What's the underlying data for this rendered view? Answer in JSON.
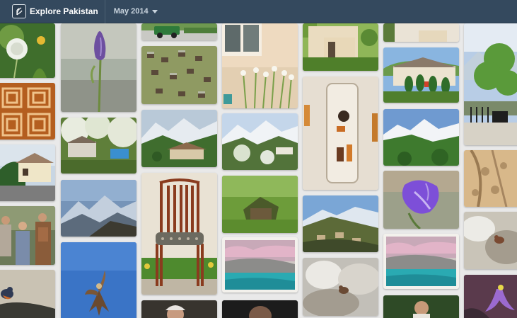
{
  "header": {
    "title": "Explore Pakistan",
    "month": "May 2014",
    "colors": {
      "bar": "#34495e",
      "text": "#ffffff",
      "muted": "#c9d4de"
    }
  },
  "photos": [
    "dandelion",
    "wooden-lattice",
    "village-houses",
    "women-outdoors",
    "perched-bird",
    "purple-iris-bud",
    "blossom-garden",
    "mountain-vista",
    "flying-eagle",
    "green-jeep",
    "hillside-huts",
    "mountain-valley",
    "wooden-chair",
    "portrait",
    "window-flowers",
    "snowy-mountains",
    "grassy-hut",
    "blossom-lake",
    "portrait",
    "yellow-building",
    "wooden-door",
    "valley-houses",
    "rock-bird",
    "sky-strip",
    "garden-house",
    "snowy-peaks",
    "purple-iris",
    "blossom-lake",
    "forest-person",
    "mountain-tree",
    "shadow-wall",
    "rock-bird",
    "purple-flower"
  ]
}
